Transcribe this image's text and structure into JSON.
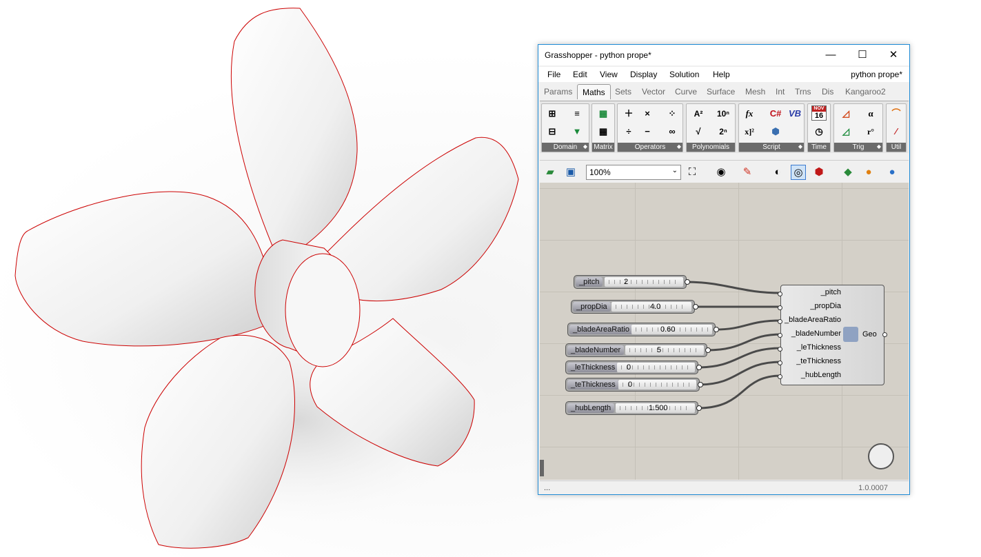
{
  "window": {
    "title": "Grasshopper - python prope*",
    "controls": [
      "minimize-icon",
      "maximize-icon",
      "close-icon"
    ],
    "controls_glyphs": [
      "—",
      "☐",
      "✕"
    ]
  },
  "menu": {
    "items": [
      "File",
      "Edit",
      "View",
      "Display",
      "Solution",
      "Help"
    ],
    "document_name": "python prope*"
  },
  "tabs": [
    "Params",
    "Maths",
    "Sets",
    "Vector",
    "Curve",
    "Surface",
    "Mesh",
    "Int",
    "Trns",
    "Dis",
    "Kangaroo2"
  ],
  "active_tab": "Maths",
  "ribbon_groups": [
    "Domain",
    "Matrix",
    "Operators",
    "Polynomials",
    "Script",
    "Time",
    "Trig",
    "Util"
  ],
  "ribbon_icons": {
    "polynomials": [
      "A²",
      "10ⁿ",
      "√",
      "2ⁿ"
    ],
    "script": [
      "fx",
      "C#",
      "VB",
      "x]²"
    ],
    "time_month": "NOV",
    "time_day": "16",
    "trig": [
      "α",
      "r°"
    ]
  },
  "canvas_toolbar": {
    "zoom": "100%"
  },
  "sliders": [
    {
      "name": "_pitch",
      "value": "2"
    },
    {
      "name": "_propDia",
      "value": "4.0"
    },
    {
      "name": "_bladeAreaRatio",
      "value": "0.60"
    },
    {
      "name": "_bladeNumber",
      "value": "5"
    },
    {
      "name": "_leThickness",
      "value": "0"
    },
    {
      "name": "_teThickness",
      "value": "0"
    },
    {
      "name": "_hubLength",
      "value": "1.500"
    }
  ],
  "component": {
    "inputs": [
      "_pitch",
      "_propDia",
      "_bladeAreaRatio",
      "_bladeNumber",
      "_leThickness",
      "_teThickness",
      "_hubLength"
    ],
    "output": "Geo"
  },
  "status": {
    "left": "...",
    "version": "1.0.0007"
  },
  "colors": {
    "accent": "#1e8bd6",
    "canvas": "#d4d0c8",
    "edge_highlight": "#cc0000"
  }
}
